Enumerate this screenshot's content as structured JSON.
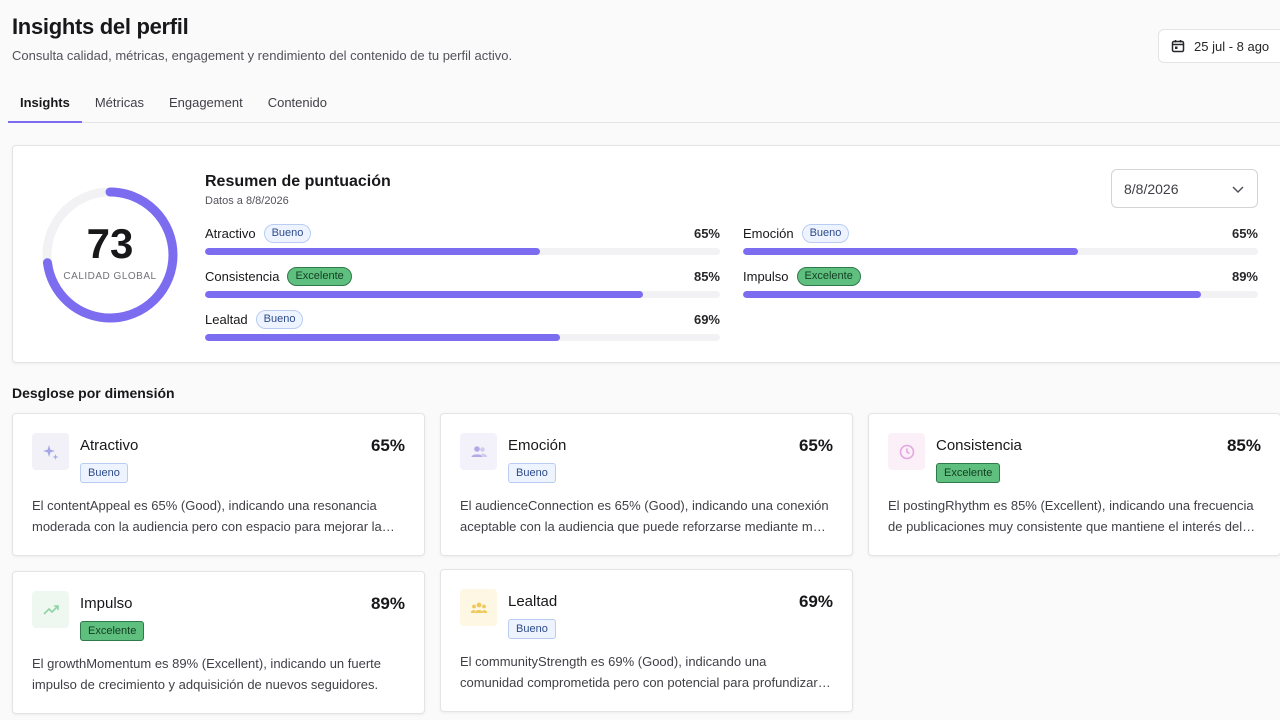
{
  "header": {
    "title": "Insights del perfil",
    "subtitle": "Consulta calidad, métricas, engagement y rendimiento del contenido de tu perfil activo.",
    "date_range": "25 jul - 8 ago"
  },
  "tabs": [
    {
      "label": "Insights",
      "active": true
    },
    {
      "label": "Métricas",
      "active": false
    },
    {
      "label": "Engagement",
      "active": false
    },
    {
      "label": "Contenido",
      "active": false
    }
  ],
  "summary": {
    "score": "73",
    "score_value": 73,
    "score_label": "CALIDAD GLOBAL",
    "title": "Resumen de puntuación",
    "date_note": "Datos a 8/8/2026",
    "date_select": "8/8/2026",
    "metrics": [
      {
        "name": "Atractivo",
        "badge": "Bueno",
        "level": "good",
        "pct": "65%",
        "value": 65
      },
      {
        "name": "Emoción",
        "badge": "Bueno",
        "level": "good",
        "pct": "65%",
        "value": 65
      },
      {
        "name": "Consistencia",
        "badge": "Excelente",
        "level": "excellent",
        "pct": "85%",
        "value": 85
      },
      {
        "name": "Impulso",
        "badge": "Excelente",
        "level": "excellent",
        "pct": "89%",
        "value": 89
      },
      {
        "name": "Lealtad",
        "badge": "Bueno",
        "level": "good",
        "pct": "69%",
        "value": 69
      }
    ]
  },
  "breakdown": {
    "title": "Desglose por dimensión",
    "cards": [
      {
        "name": "Atractivo",
        "pct": "65%",
        "badge": "Bueno",
        "level": "good",
        "icon": "sparkles-icon",
        "desc": "El contentAppeal es 65% (Good), indicando una resonancia moderada con la audiencia pero con espacio para mejorar la presentación del contenido."
      },
      {
        "name": "Emoción",
        "pct": "65%",
        "badge": "Bueno",
        "level": "good",
        "icon": "users-icon",
        "desc": "El audienceConnection es 65% (Good), indicando una conexión aceptable con la audiencia que puede reforzarse mediante más interacción."
      },
      {
        "name": "Consistencia",
        "pct": "85%",
        "badge": "Excelente",
        "level": "excellent",
        "icon": "clock-icon",
        "desc": "El postingRhythm es 85% (Excellent), indicando una frecuencia de publicaciones muy consistente que mantiene el interés del público."
      },
      {
        "name": "Impulso",
        "pct": "89%",
        "badge": "Excelente",
        "level": "excellent",
        "icon": "trending-up-icon",
        "desc": "El growthMomentum es 89% (Excellent), indicando un fuerte impulso de crecimiento y adquisición de nuevos seguidores."
      },
      {
        "name": "Lealtad",
        "pct": "69%",
        "badge": "Bueno",
        "level": "good",
        "icon": "community-icon",
        "desc": "El communityStrength es 69% (Good), indicando una comunidad comprometida pero con potencial para profundizar la lealtad."
      }
    ]
  },
  "colors": {
    "accent": "#7c6cf0",
    "good_badge_bg": "#eef4ff",
    "excellent_badge_bg": "#5fbf7e"
  }
}
